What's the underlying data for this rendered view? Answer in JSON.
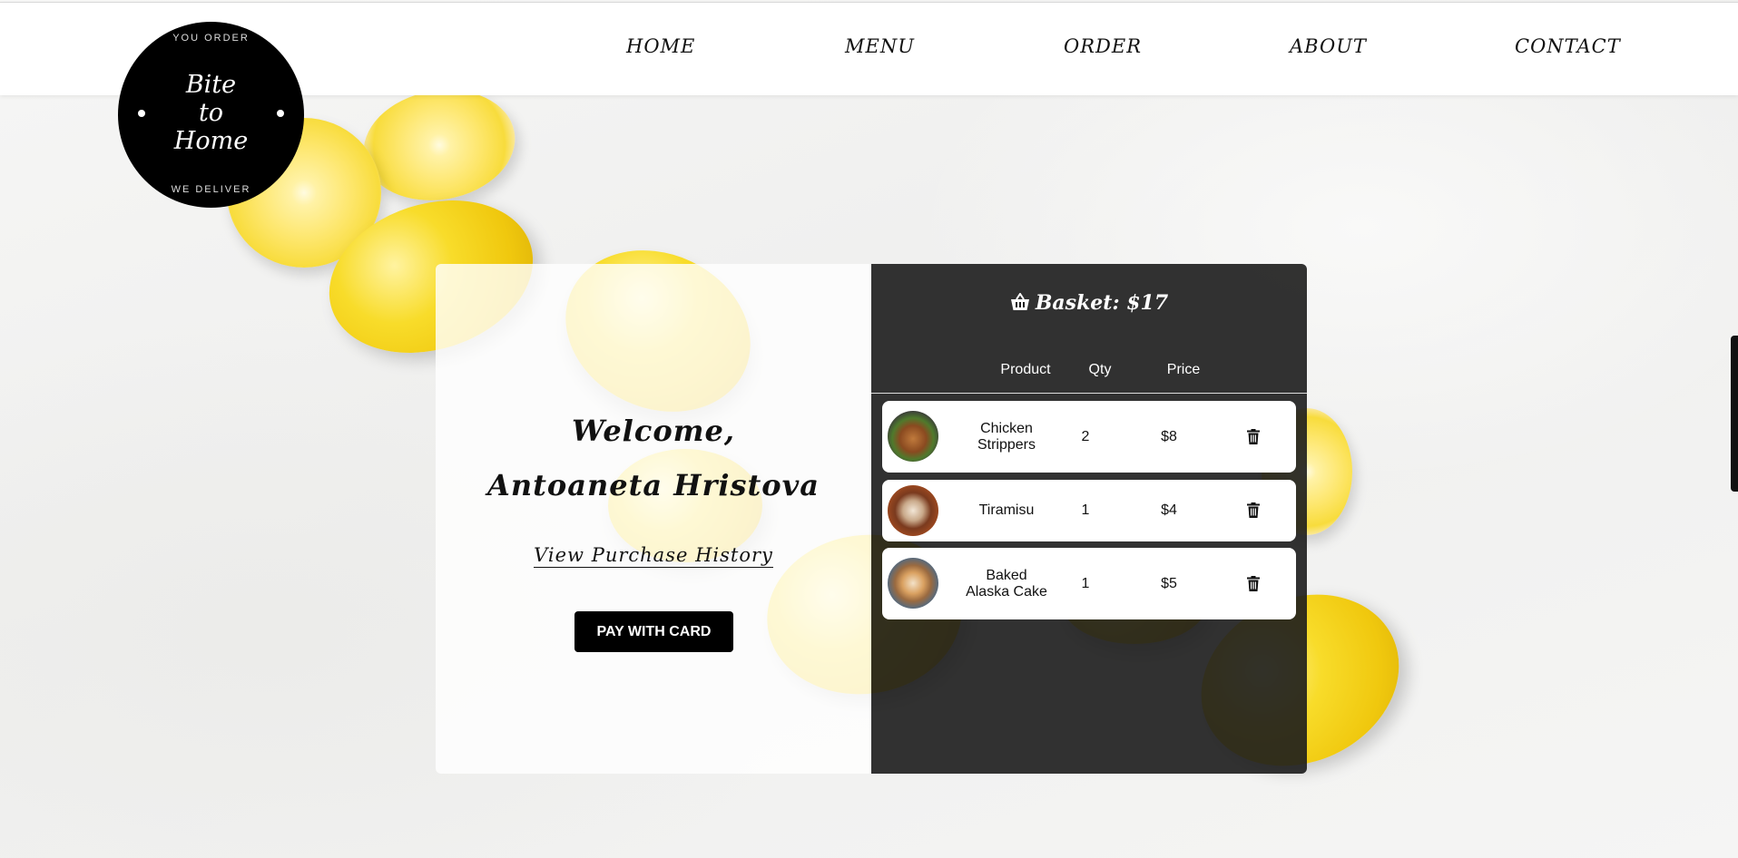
{
  "logo": {
    "top_text": "YOU ORDER",
    "brand_line1": "Bite",
    "brand_line2": "to",
    "brand_line3": "Home",
    "bottom_text": "WE DELIVER"
  },
  "nav": {
    "items": [
      {
        "label": "HOME"
      },
      {
        "label": "MENU"
      },
      {
        "label": "ORDER"
      },
      {
        "label": "ABOUT"
      },
      {
        "label": "CONTACT"
      }
    ]
  },
  "welcome": {
    "line1": "Welcome,",
    "line2": "Antoaneta Hristova",
    "history_link": "View Purchase History",
    "pay_button": "PAY WITH CARD"
  },
  "basket": {
    "title": "Basket: $17",
    "icon": "basket-icon",
    "columns": {
      "product": "Product",
      "qty": "Qty",
      "price": "Price"
    },
    "items": [
      {
        "name": "Chicken Strippers",
        "qty": "2",
        "price": "$8"
      },
      {
        "name": "Tiramisu",
        "qty": "1",
        "price": "$4"
      },
      {
        "name": "Baked Alaska Cake",
        "qty": "1",
        "price": "$5"
      }
    ]
  },
  "colors": {
    "panel_dark": "#1c1c1c",
    "lemon_yellow": "#f8dc2a",
    "button_black": "#000000"
  }
}
